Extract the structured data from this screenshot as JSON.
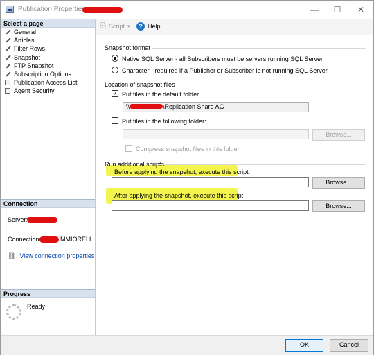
{
  "window": {
    "title": "Publication Properties",
    "minimize_glyph": "—",
    "maximize_glyph": "☐",
    "close_glyph": "✕"
  },
  "sidebar": {
    "select_page_header": "Select a page",
    "items": [
      {
        "label": "General",
        "icon": "wrench-icon"
      },
      {
        "label": "Articles",
        "icon": "page-icon"
      },
      {
        "label": "Filter Rows",
        "icon": "page-icon"
      },
      {
        "label": "Snapshot",
        "icon": "page-icon"
      },
      {
        "label": "FTP Snapshot",
        "icon": "page-icon"
      },
      {
        "label": "Subscription Options",
        "icon": "page-icon"
      },
      {
        "label": "Publication Access List",
        "icon": "page-icon"
      },
      {
        "label": "Agent Security",
        "icon": "page-icon"
      }
    ],
    "connection": {
      "header": "Connection",
      "server_label": "Server:",
      "connection_label": "Connection:",
      "connection_value_visible": "MMIORELL",
      "view_props_link": "View connection properties"
    },
    "progress": {
      "header": "Progress",
      "status": "Ready"
    }
  },
  "toolbar": {
    "script_label": "Script",
    "help_label": "Help"
  },
  "snapshot_format": {
    "group_label": "Snapshot format",
    "option_native": "Native SQL Server - all Subscribers must be servers running SQL Server",
    "option_character": "Character - required if a Publisher or Subscriber is not running SQL Server",
    "selected": "native"
  },
  "location": {
    "group_label": "Location of snapshot files",
    "default_folder_label": "Put files in the default folder",
    "default_folder_checked": true,
    "default_folder_path_prefix": "\\\\",
    "default_folder_path_suffix": "\\Replication Share AG",
    "following_folder_label": "Put files in the following folder:",
    "following_folder_checked": false,
    "following_folder_value": "",
    "browse_label": "Browse...",
    "compress_label": "Compress snapshot files in this folder"
  },
  "scripts": {
    "group_label": "Run additional scripts",
    "before_label": "Before applying the snapshot, execute this script:",
    "before_value": "",
    "after_label": "After applying the snapshot, execute this script:",
    "after_value": "",
    "browse_label": "Browse..."
  },
  "footer": {
    "ok_label": "OK",
    "cancel_label": "Cancel"
  },
  "colors": {
    "highlight": "#f0f014",
    "redaction": "#e01010",
    "link": "#0645ad"
  }
}
